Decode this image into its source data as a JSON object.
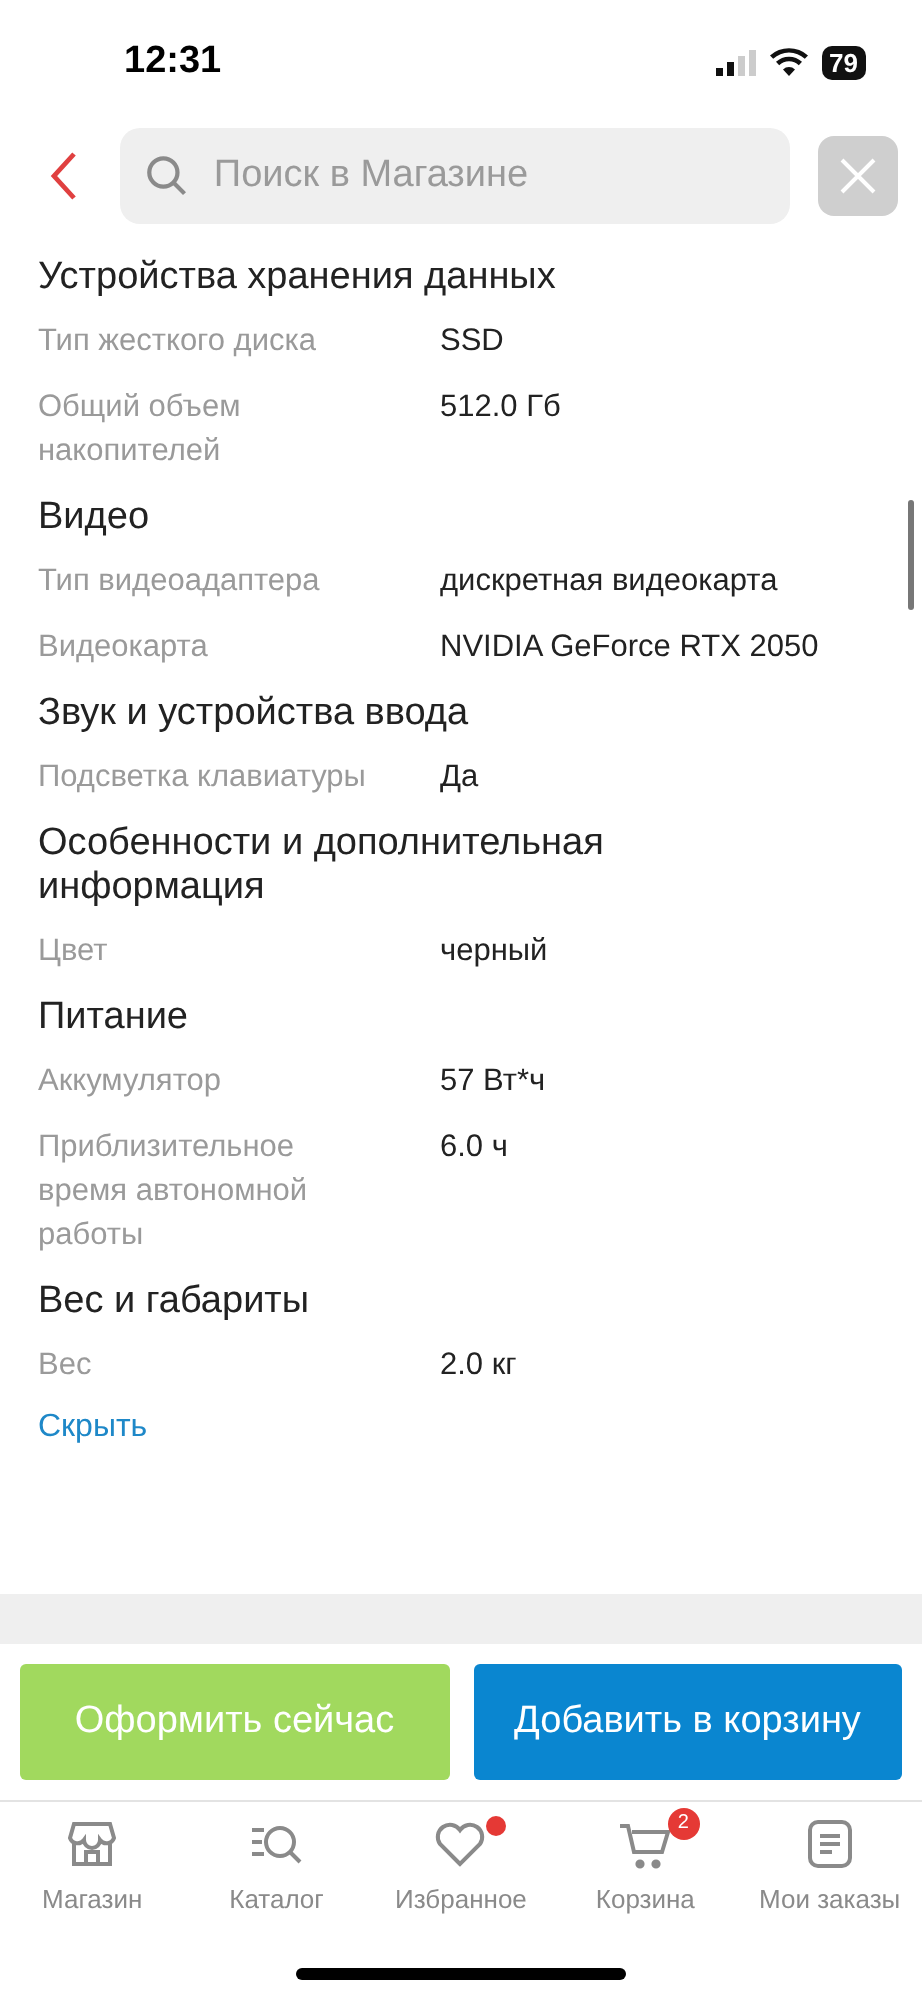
{
  "status_bar": {
    "time": "12:31",
    "battery": "79"
  },
  "search": {
    "placeholder": "Поиск в Магазине"
  },
  "sections": [
    {
      "title": "Устройства хранения данных",
      "rows": [
        {
          "label": "Тип жесткого диска",
          "value": "SSD"
        },
        {
          "label": "Общий объем накопителей",
          "value": "512.0 Гб"
        }
      ]
    },
    {
      "title": "Видео",
      "rows": [
        {
          "label": "Тип видеоадаптера",
          "value": "дискретная видеокарта"
        },
        {
          "label": "Видеокарта",
          "value": "NVIDIA GeForce RTX 2050"
        }
      ]
    },
    {
      "title": "Звук и устройства ввода",
      "rows": [
        {
          "label": "Подсветка клавиатуры",
          "value": "Да"
        }
      ]
    },
    {
      "title": "Особенности и дополнительная информация",
      "rows": [
        {
          "label": "Цвет",
          "value": "черный"
        }
      ]
    },
    {
      "title": "Питание",
      "rows": [
        {
          "label": "Аккумулятор",
          "value": "57 Вт*ч"
        },
        {
          "label": "Приблизительное время автономной работы",
          "value": "6.0 ч"
        }
      ]
    },
    {
      "title": "Вес и габариты",
      "rows": [
        {
          "label": "Вес",
          "value": "2.0 кг"
        }
      ]
    }
  ],
  "hide_link": "Скрыть",
  "buttons": [
    {
      "label": "Оформить сейчас",
      "kind": "checkout"
    },
    {
      "label": "Добавить в корзину",
      "kind": "cart"
    }
  ],
  "tabs": [
    {
      "label": "Магазин",
      "kind": "store"
    },
    {
      "label": "Каталог",
      "kind": "catalog"
    },
    {
      "label": "Избранное",
      "kind": "heart",
      "dot": true
    },
    {
      "label": "Корзина",
      "kind": "cart",
      "badge": "2"
    },
    {
      "label": "Мои заказы",
      "kind": "orders"
    }
  ]
}
